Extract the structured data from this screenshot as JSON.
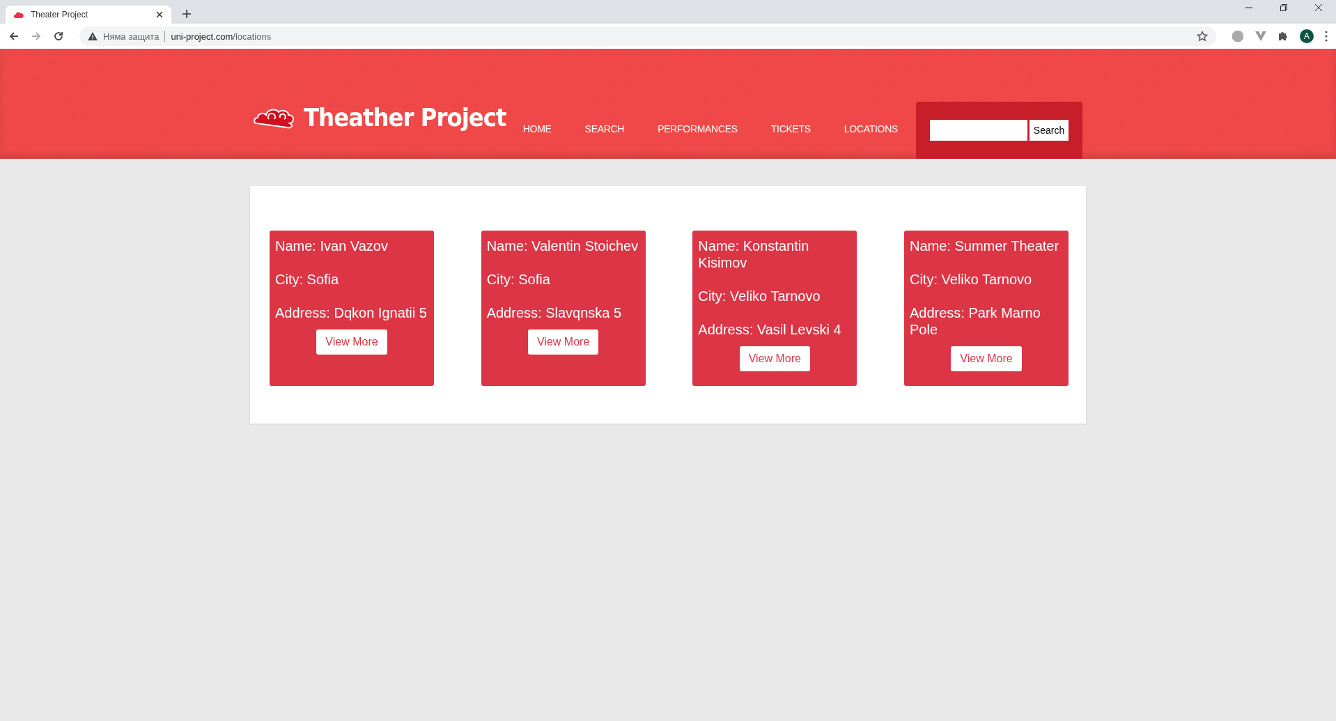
{
  "browser": {
    "tab_title": "Theater Project",
    "security_label": "Няма защита",
    "url_host": "uni-project.com",
    "url_path": "/locations",
    "profile_initial": "A"
  },
  "site": {
    "logo_text": "Theather Project",
    "nav": [
      "HOME",
      "SEARCH",
      "PERFORMANCES",
      "TICKETS",
      "LOCATIONS"
    ],
    "search_button": "Search"
  },
  "locations": [
    {
      "name": "Name: Ivan Vazov",
      "city": "City: Sofia",
      "address": "Address: Dqkon Ignatii 5",
      "button": "View More"
    },
    {
      "name": "Name: Valentin Stoichev",
      "city": "City: Sofia",
      "address": "Address: Slavqnska 5",
      "button": "View More"
    },
    {
      "name": "Name: Konstantin Kisimov",
      "city": "City: Veliko Tarnovo",
      "address": "Address: Vasil Levski 4",
      "button": "View More"
    },
    {
      "name": "Name: Summer Theater",
      "city": "City: Veliko Tarnovo",
      "address": "Address: Park Marno Pole",
      "button": "View More"
    }
  ]
}
